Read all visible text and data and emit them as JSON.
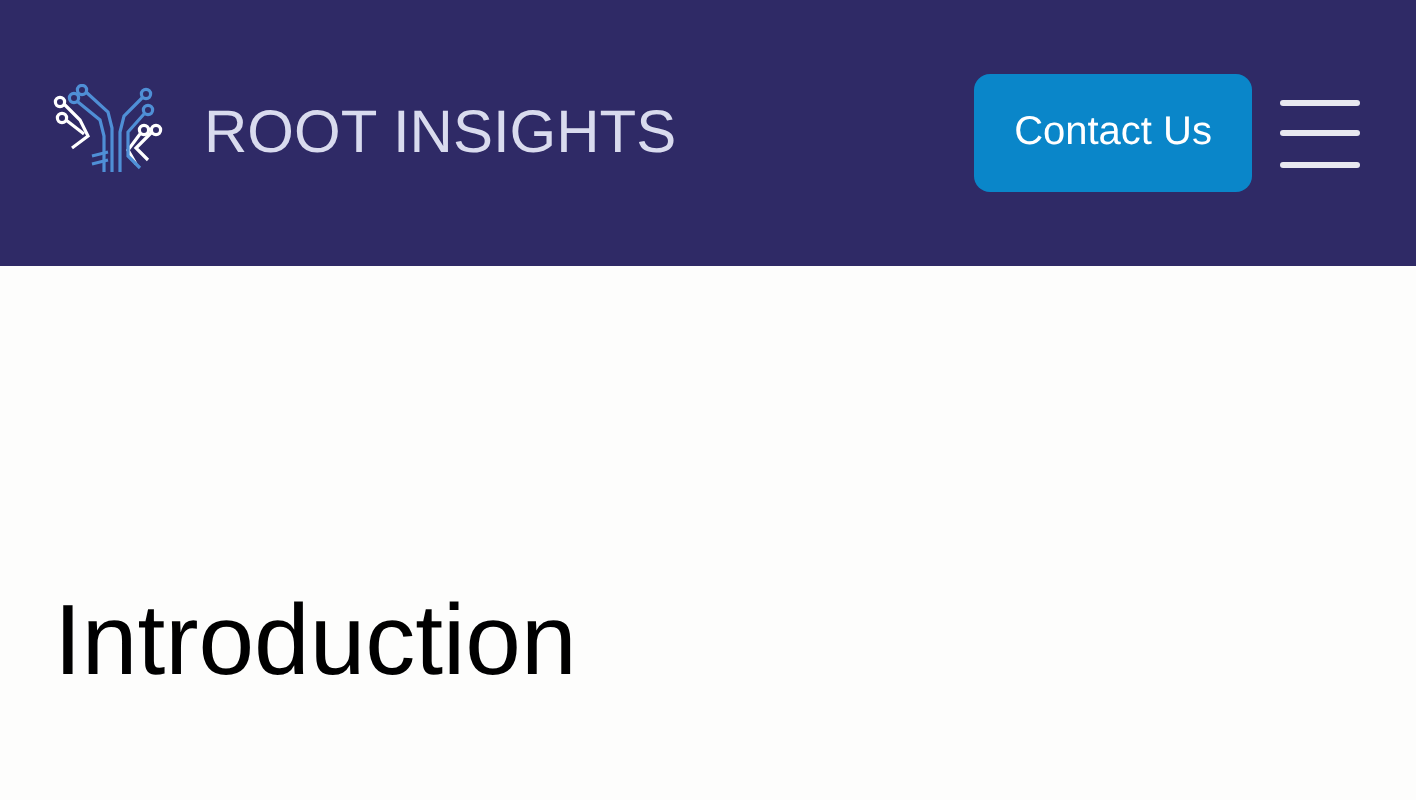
{
  "header": {
    "brand": "ROOT INSIGHTS",
    "contact_button": "Contact Us"
  },
  "content": {
    "heading": "Introduction"
  }
}
